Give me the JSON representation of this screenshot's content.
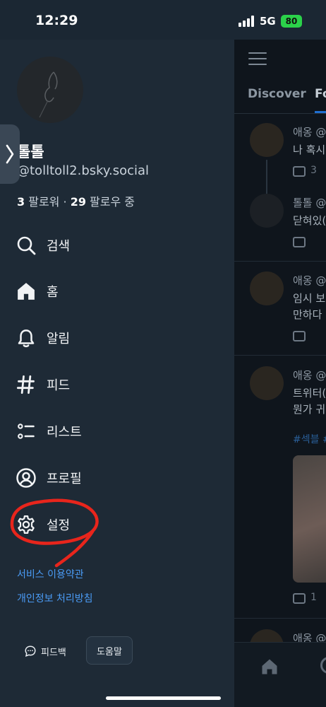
{
  "status_bar": {
    "time": "12:29",
    "network": "5G",
    "battery": "80"
  },
  "profile": {
    "display_name": "톨톨",
    "handle": "@tolltoll2.bsky.social",
    "followers_count": "3",
    "followers_label": "팔로워",
    "separator": "·",
    "following_count": "29",
    "following_label": "팔로우 중"
  },
  "menu": [
    {
      "label": "검색",
      "icon": "search-icon"
    },
    {
      "label": "홈",
      "icon": "home-icon"
    },
    {
      "label": "알림",
      "icon": "bell-icon"
    },
    {
      "label": "피드",
      "icon": "hash-icon"
    },
    {
      "label": "리스트",
      "icon": "list-icon"
    },
    {
      "label": "프로필",
      "icon": "profile-icon"
    },
    {
      "label": "설정",
      "icon": "gear-icon"
    }
  ],
  "links": {
    "terms": "서비스 이용약관",
    "privacy": "개인정보 처리방침"
  },
  "footer": {
    "feedback": "피드백",
    "help": "도움말"
  },
  "feed": {
    "tabs": [
      "Discover",
      "Fo"
    ],
    "posts": [
      {
        "author": "애옹 @",
        "text": [
          "나 혹시"
        ],
        "replies": "3"
      },
      {
        "author": "톨톨 @",
        "text": [
          "닫혀있("
        ],
        "replies": ""
      },
      {
        "author": "애옹 @",
        "text": [
          "임시 보",
          "만하다"
        ],
        "replies": ""
      },
      {
        "author": "애옹 @",
        "text": [
          "트위터(",
          "뭔가 귀"
        ],
        "replies": "1"
      },
      {
        "author": "애옹 @",
        "text": [],
        "replies": ""
      }
    ],
    "hashtag": "#섹블 #"
  },
  "colors": {
    "drawer_bg": "#1e2a36",
    "link": "#4a9bf5",
    "annotation": "#e8251c",
    "battery": "#2bd24a"
  }
}
